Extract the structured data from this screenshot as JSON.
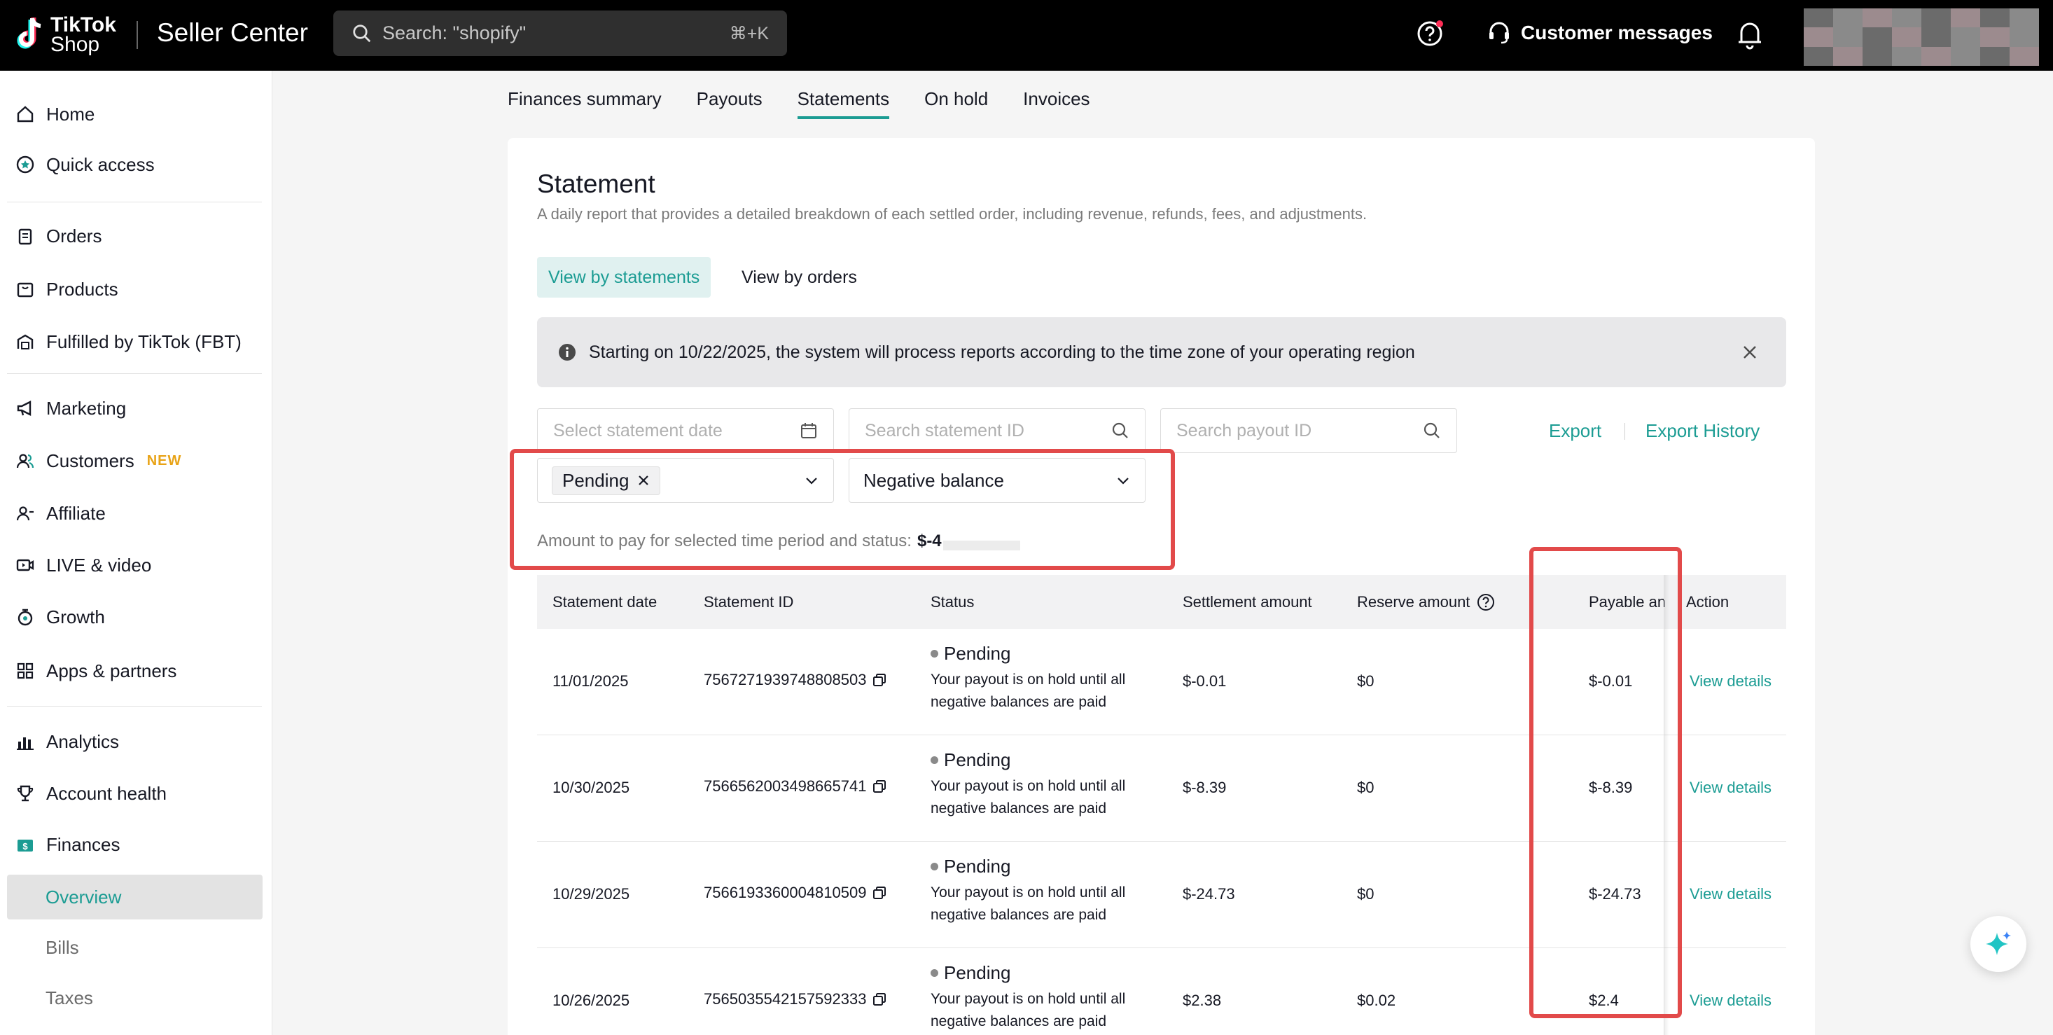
{
  "header": {
    "logo_line1": "TikTok",
    "logo_line2": "Shop",
    "app_name": "Seller Center",
    "search_placeholder": "Search: \"shopify\"",
    "search_shortcut": "⌘+K",
    "customer_messages": "Customer messages"
  },
  "sidebar": {
    "home": "Home",
    "quick_access": "Quick access",
    "orders": "Orders",
    "products": "Products",
    "fbt": "Fulfilled by TikTok (FBT)",
    "marketing": "Marketing",
    "customers": "Customers",
    "customers_badge": "NEW",
    "affiliate": "Affiliate",
    "live_video": "LIVE & video",
    "growth": "Growth",
    "apps_partners": "Apps & partners",
    "analytics": "Analytics",
    "account_health": "Account health",
    "finances": "Finances",
    "overview": "Overview",
    "bills": "Bills",
    "taxes": "Taxes"
  },
  "tabs": [
    "Finances summary",
    "Payouts",
    "Statements",
    "On hold",
    "Invoices"
  ],
  "statement": {
    "title": "Statement",
    "subtitle": "A daily report that provides a detailed breakdown of each settled order, including revenue, refunds, fees, and adjustments.",
    "view_by_statements": "View by statements",
    "view_by_orders": "View by orders",
    "notice": "Starting on 10/22/2025, the system will process reports according to the time zone of your operating region",
    "date_placeholder": "Select statement date",
    "statement_id_placeholder": "Search statement ID",
    "payout_id_placeholder": "Search payout ID",
    "export": "Export",
    "export_history": "Export History",
    "status_chip": "Pending",
    "balance_filter": "Negative balance",
    "amount_label": "Amount to pay for selected time period and status:",
    "amount_value": "$-4"
  },
  "table": {
    "headers": {
      "date": "Statement date",
      "id": "Statement ID",
      "status": "Status",
      "settlement": "Settlement amount",
      "reserve": "Reserve amount",
      "payable": "Payable an",
      "action": "Action"
    },
    "rows": [
      {
        "date": "11/01/2025",
        "id": "7567271939748808503",
        "status": "Pending",
        "desc": "Your payout is on hold until all negative balances are paid",
        "settlement": "$-0.01",
        "reserve": "$0",
        "payable": "$-0.01",
        "action": "View details"
      },
      {
        "date": "10/30/2025",
        "id": "7566562003498665741",
        "status": "Pending",
        "desc": "Your payout is on hold until all negative balances are paid",
        "settlement": "$-8.39",
        "reserve": "$0",
        "payable": "$-8.39",
        "action": "View details"
      },
      {
        "date": "10/29/2025",
        "id": "7566193360004810509",
        "status": "Pending",
        "desc": "Your payout is on hold until all negative balances are paid",
        "settlement": "$-24.73",
        "reserve": "$0",
        "payable": "$-24.73",
        "action": "View details"
      },
      {
        "date": "10/26/2025",
        "id": "7565035542157592333",
        "status": "Pending",
        "desc": "Your payout is on hold until all negative balances are paid",
        "settlement": "$2.38",
        "reserve": "$0.02",
        "payable": "$2.4",
        "action": "View details"
      }
    ]
  },
  "colors": {
    "accent": "#1b9c93",
    "highlight": "#e24a4a",
    "new_badge": "#e8a317"
  }
}
